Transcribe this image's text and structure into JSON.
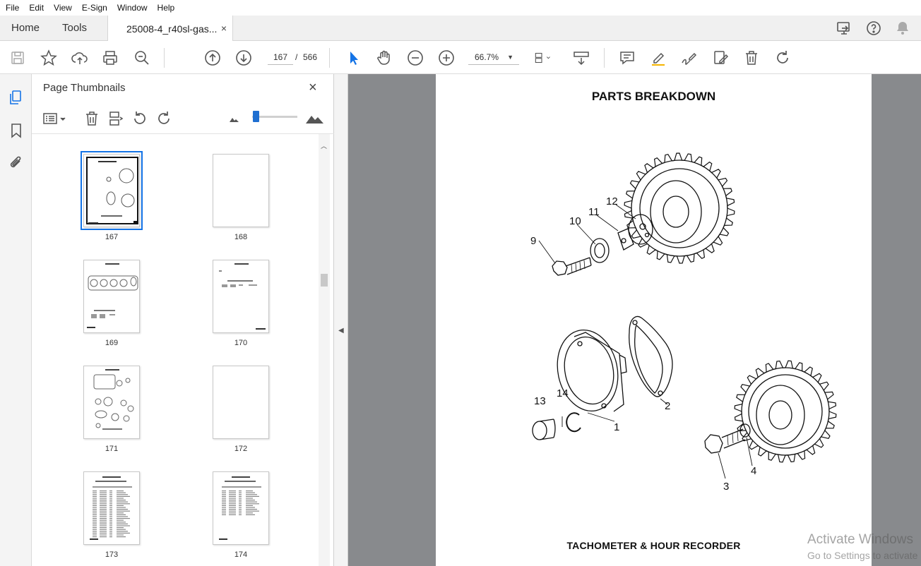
{
  "menu": [
    "File",
    "Edit",
    "View",
    "E-Sign",
    "Window",
    "Help"
  ],
  "tabs": {
    "home": "Home",
    "tools": "Tools",
    "document": "25008-4_r40sl-gas...",
    "close": "×"
  },
  "toolbar": {
    "current_page": "167",
    "page_sep": "/",
    "total_pages": "566",
    "zoom": "66.7%"
  },
  "panel": {
    "title": "Page Thumbnails",
    "close": "×",
    "thumbnails": [
      {
        "label": "167",
        "kind": "drawing",
        "selected": true
      },
      {
        "label": "168",
        "kind": "blank",
        "selected": false
      },
      {
        "label": "169",
        "kind": "gaskets",
        "selected": false
      },
      {
        "label": "170",
        "kind": "sparse",
        "selected": false
      },
      {
        "label": "171",
        "kind": "gaskets2",
        "selected": false
      },
      {
        "label": "172",
        "kind": "blank",
        "selected": false
      },
      {
        "label": "173",
        "kind": "table",
        "selected": false
      },
      {
        "label": "174",
        "kind": "table2",
        "selected": false
      }
    ]
  },
  "page": {
    "title": "PARTS BREAKDOWN",
    "caption": "TACHOMETER & HOUR RECORDER",
    "callouts": [
      "9",
      "10",
      "11",
      "12",
      "13",
      "14",
      "1",
      "2",
      "3",
      "4"
    ]
  },
  "watermark": {
    "line1": "Activate Windows",
    "line2": "Go to Settings to activate"
  }
}
